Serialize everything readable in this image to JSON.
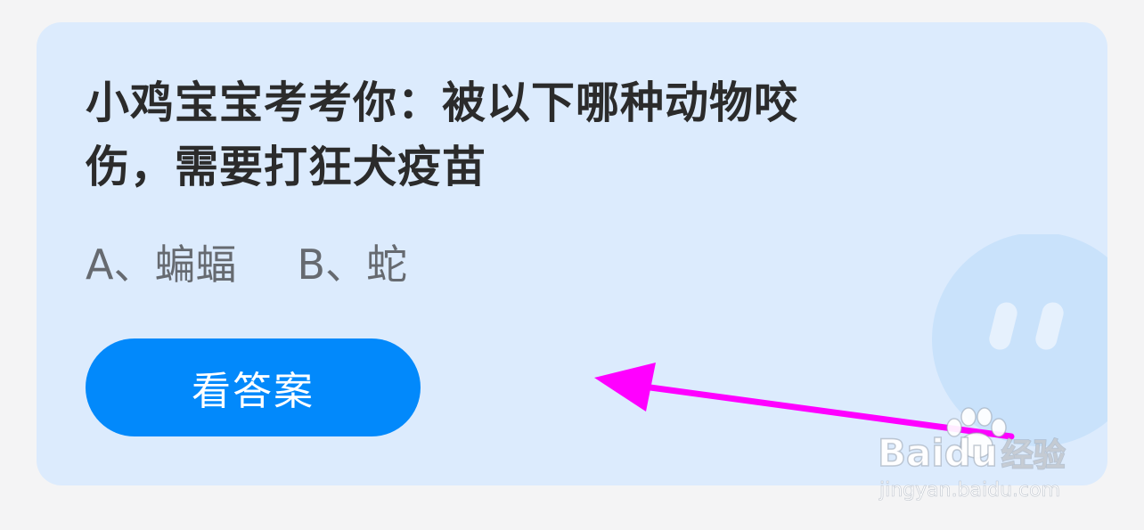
{
  "quiz": {
    "question_line1": "小鸡宝宝考考你：被以下哪种动物咬",
    "question_line2": "伤，需要打狂犬疫苗",
    "option_a": "A、蝙蝠",
    "option_b": "B、蛇",
    "answer_button_label": "看答案"
  },
  "watermark": {
    "logo_text": "Bai",
    "logo_text_2": "du",
    "logo_text_3": "经验",
    "url": "jingyan.baidu.com"
  },
  "icons": {
    "mascot": "mascot-face-icon",
    "arrow": "annotation-arrow",
    "paw": "baidu-paw-icon"
  },
  "colors": {
    "card_background": "#dcebfd",
    "button": "#0289fb",
    "arrow": "#ff00ff",
    "question_text": "#2b2b2b",
    "option_text": "#666a70"
  }
}
